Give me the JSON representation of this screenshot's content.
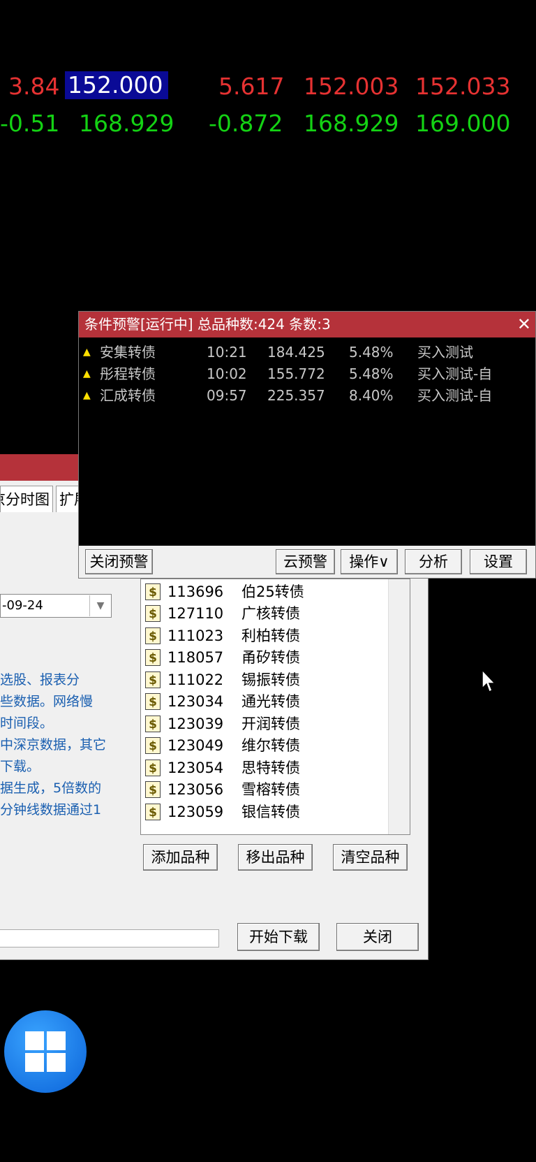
{
  "quotes": {
    "row1": [
      "3.84",
      "152.000",
      "5.617",
      "152.003",
      "152.033"
    ],
    "row2": [
      "-0.51",
      "168.929",
      "-0.872",
      "168.929",
      "169.000"
    ]
  },
  "alert": {
    "title": "条件预警[运行中] 总品种数:424 条数:3",
    "close": "✕",
    "rows": [
      {
        "name": "安集转债",
        "time": "10:21",
        "price": "184.425",
        "pct": "5.48%",
        "signal": "买入测试"
      },
      {
        "name": "彤程转债",
        "time": "10:02",
        "price": "155.772",
        "pct": "5.48%",
        "signal": "买入测试-自"
      },
      {
        "name": "汇成转债",
        "time": "09:57",
        "price": "225.357",
        "pct": "8.40%",
        "signal": "买入测试-自"
      }
    ],
    "buttons": {
      "close_alert": "关闭预警",
      "cloud": "云预警",
      "ops": "操作∨",
      "analyze": "分析",
      "settings": "设置"
    }
  },
  "download": {
    "tabs": [
      "京分时图",
      "扩展"
    ],
    "date": "-09-24",
    "description": [
      "选股、报表分",
      "些数据。网络慢",
      "时间段。",
      "中深京数据，其它",
      "下载。",
      "据生成，5倍数的",
      "分钟线数据通过1"
    ],
    "list": [
      {
        "code": "113696",
        "name": "伯25转债"
      },
      {
        "code": "127110",
        "name": "广核转债"
      },
      {
        "code": "111023",
        "name": "利柏转债"
      },
      {
        "code": "118057",
        "name": "甬矽转债"
      },
      {
        "code": "111022",
        "name": "锡振转债"
      },
      {
        "code": "123034",
        "name": "通光转债"
      },
      {
        "code": "123039",
        "name": "开润转债"
      },
      {
        "code": "123049",
        "name": "维尔转债"
      },
      {
        "code": "123054",
        "name": "思特转债"
      },
      {
        "code": "123056",
        "name": "雪榕转债"
      },
      {
        "code": "123059",
        "name": "银信转债"
      }
    ],
    "buttons": {
      "add": "添加品种",
      "remove": "移出品种",
      "clear": "清空品种",
      "start": "开始下载",
      "close": "关闭"
    }
  },
  "colors": {
    "up": "#e63232",
    "down": "#14d214",
    "title_bar": "#b5323a",
    "alert_arrow": "#ffe000"
  }
}
